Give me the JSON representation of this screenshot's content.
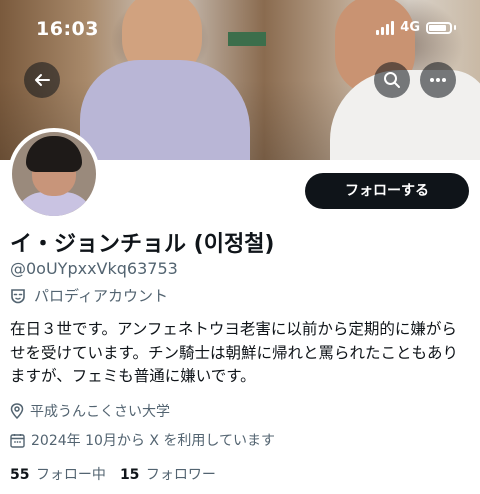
{
  "status_bar": {
    "time": "16:03",
    "network": "4G"
  },
  "header": {
    "back_icon": "arrow-left-icon",
    "search_icon": "search-icon",
    "more_icon": "more-icon"
  },
  "profile": {
    "follow_label": "フォローする",
    "name": "イ・ジョンチョル (이정철)",
    "handle": "@0oUYpxxVkq63753",
    "parody_label": "パロディアカウント",
    "bio": "在日３世です。アンフェネトウヨ老害に以前から定期的に嫌がらせを受けています。チン騎士は朝鮮に帰れと罵られたこともありますが、フェミも普通に嫌いです。",
    "location": "平成うんこくさい大学",
    "joined": "2024年 10月から X を利用しています",
    "following_count": "55",
    "following_label": "フォロー中",
    "followers_count": "15",
    "followers_label": "フォロワー"
  },
  "colors": {
    "primary_text": "#0f1419",
    "secondary_text": "#536471",
    "button_bg": "#0f1419"
  }
}
